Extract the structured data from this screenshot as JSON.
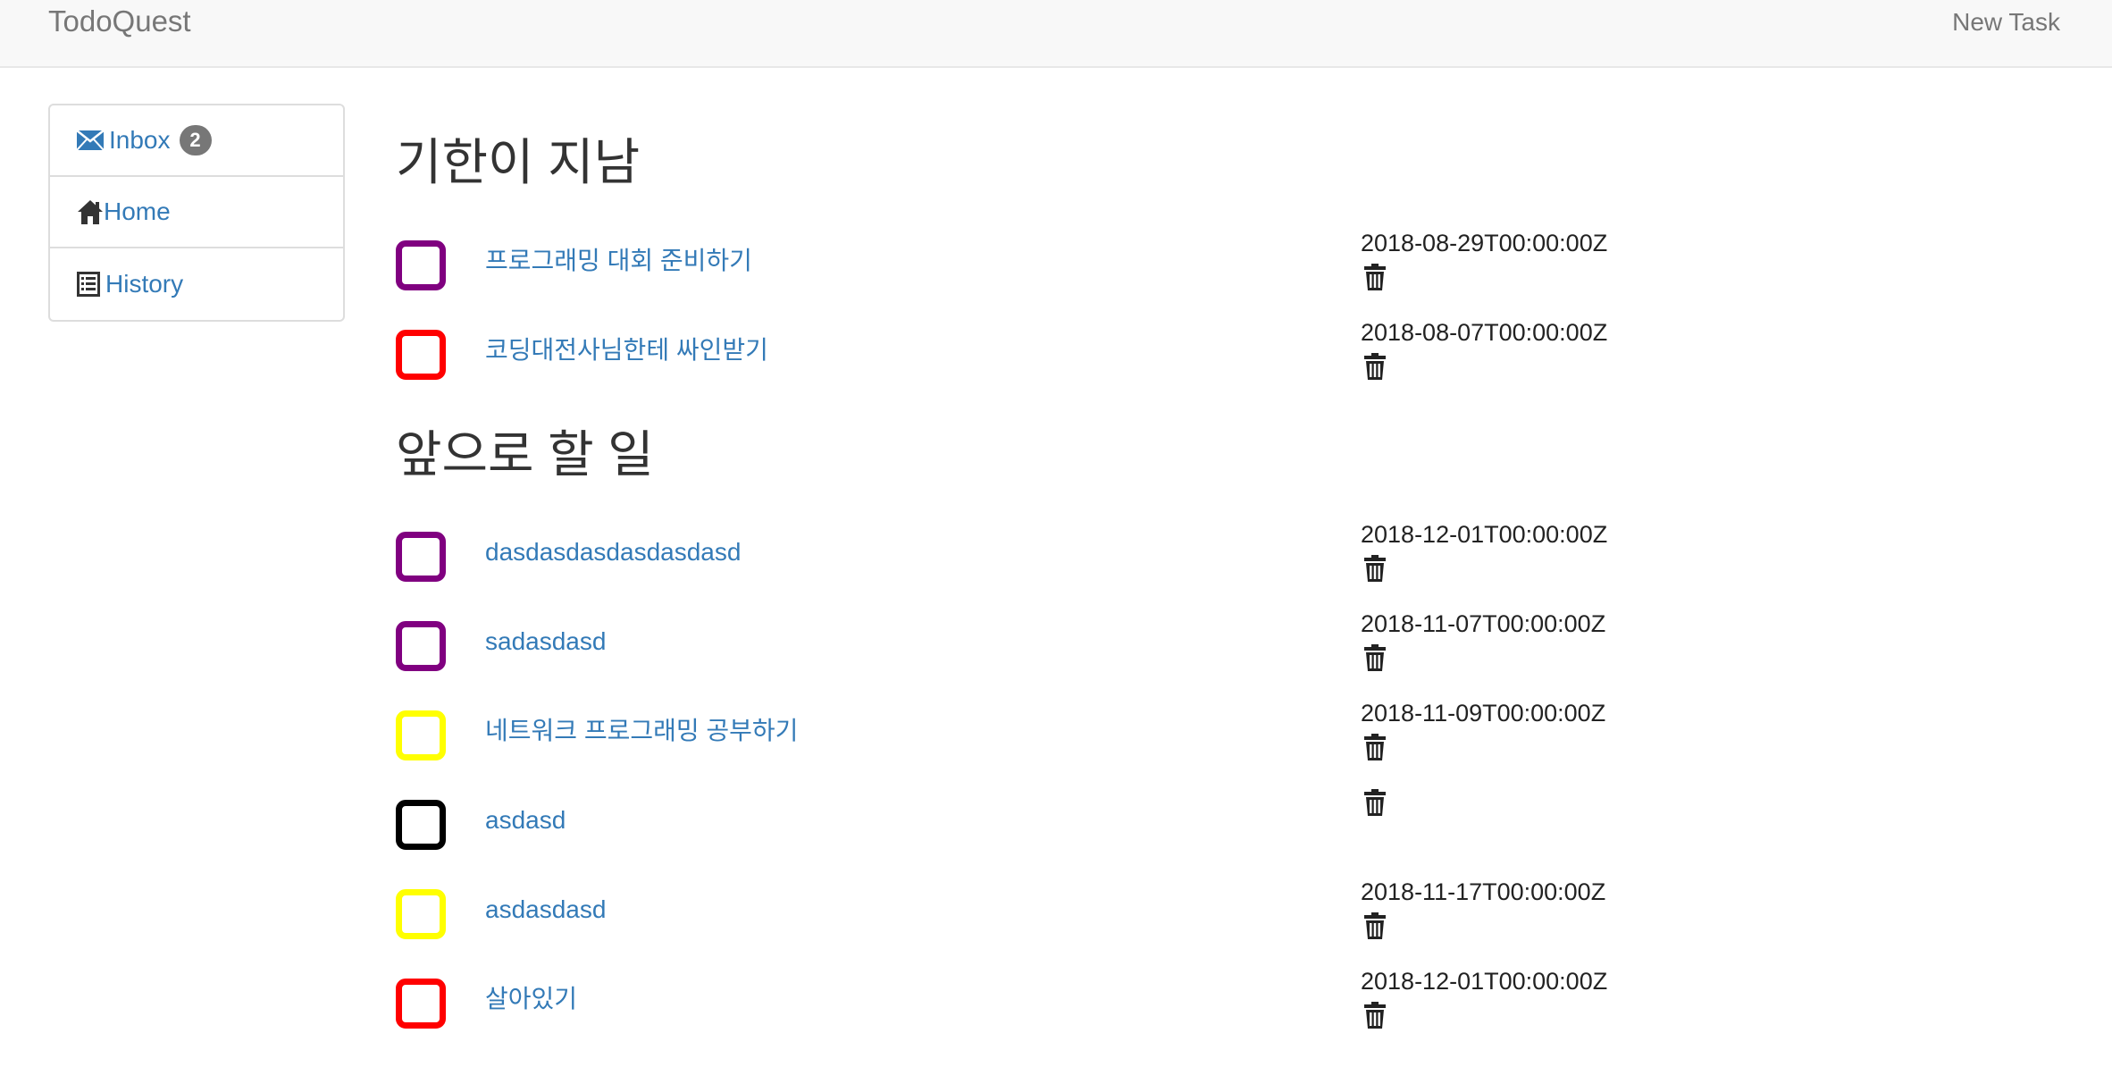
{
  "app": {
    "brand": "TodoQuest",
    "new_task_label": "New Task"
  },
  "sidebar": {
    "items": [
      {
        "label": "Inbox",
        "icon": "envelope-icon",
        "badge": "2"
      },
      {
        "label": "Home",
        "icon": "home-icon"
      },
      {
        "label": "History",
        "icon": "list-icon"
      }
    ]
  },
  "sections": {
    "overdue": {
      "title": "기한이 지남",
      "tasks": [
        {
          "name": "프로그래밍 대회 준비하기",
          "due": "2018-08-29T00:00:00Z",
          "color": "#800080"
        },
        {
          "name": "코딩대전사님한테 싸인받기",
          "due": "2018-08-07T00:00:00Z",
          "color": "#ff0000"
        }
      ]
    },
    "upcoming": {
      "title": "앞으로 할 일",
      "tasks": [
        {
          "name": "dasdasdasdasdasdasd",
          "due": "2018-12-01T00:00:00Z",
          "color": "#800080"
        },
        {
          "name": "sadasdasd",
          "due": "2018-11-07T00:00:00Z",
          "color": "#800080"
        },
        {
          "name": "네트워크 프로그래밍 공부하기",
          "due": "2018-11-09T00:00:00Z",
          "color": "#ffff00"
        },
        {
          "name": "asdasd",
          "due": "",
          "color": "#000000"
        },
        {
          "name": "asdasdasd",
          "due": "2018-11-17T00:00:00Z",
          "color": "#ffff00"
        },
        {
          "name": "살아있기",
          "due": "2018-12-01T00:00:00Z",
          "color": "#ff0000"
        }
      ]
    }
  }
}
